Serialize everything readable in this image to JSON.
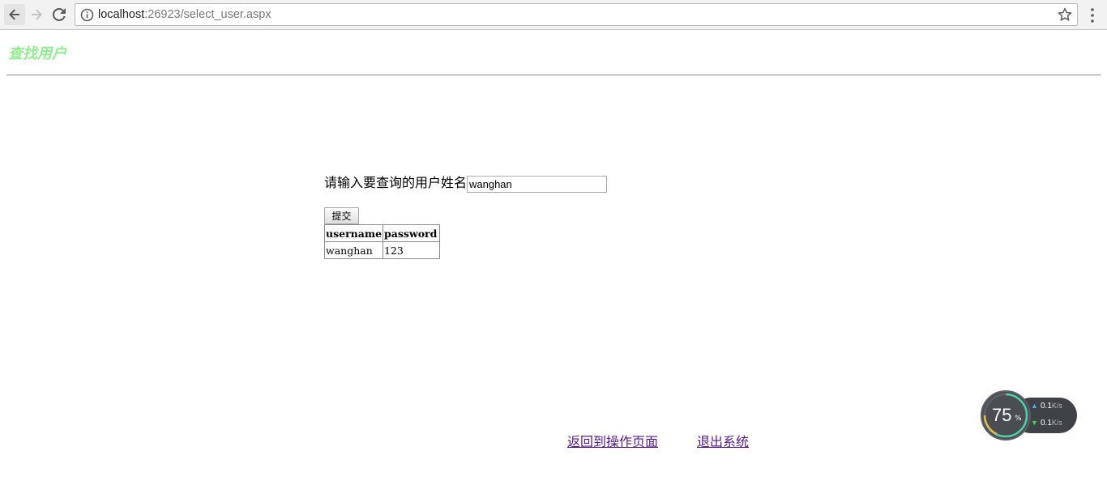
{
  "browser": {
    "url_host": "localhost",
    "url_rest": ":26923/select_user.aspx"
  },
  "page": {
    "title": "查找用户",
    "prompt_label": "请输入要查询的用户姓名",
    "name_input_value": "wanghan",
    "submit_label": "提交",
    "table": {
      "headers": [
        "username",
        "password"
      ],
      "rows": [
        [
          "wanghan",
          "123"
        ]
      ]
    },
    "links": {
      "back": "返回到操作页面",
      "exit": "退出系统"
    }
  },
  "widget": {
    "percent": "75",
    "percent_sign": "%",
    "upload_speed": "0.1",
    "download_speed": "0.1",
    "unit": "K/s"
  }
}
